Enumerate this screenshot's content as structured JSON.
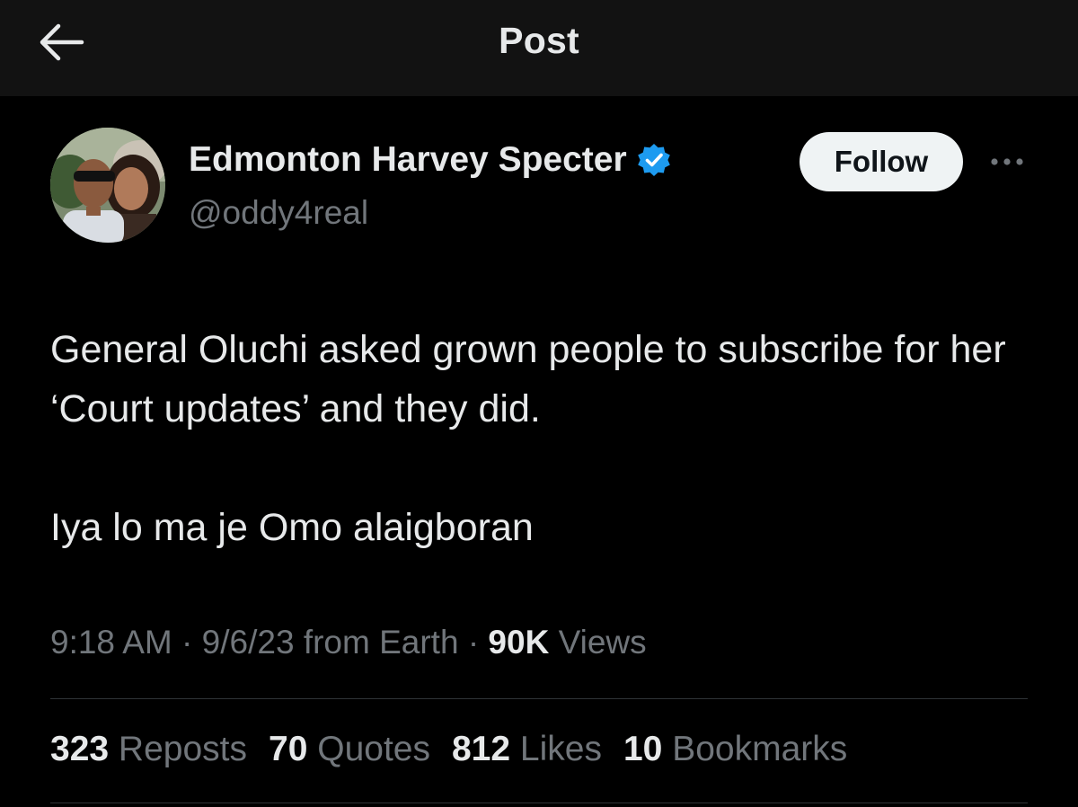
{
  "header": {
    "title": "Post",
    "back_icon": "arrow-left-icon"
  },
  "author": {
    "display_name": "Edmonton Harvey Specter",
    "handle": "@oddy4real",
    "verified_color": "#1d9bf0",
    "follow_label": "Follow",
    "more_icon": "more-dots-icon"
  },
  "tweet": {
    "paragraphs": [
      "General Oluchi asked grown people to subscribe for her ‘Court updates’ and they did.",
      "Iya lo ma je Omo alaigboran"
    ]
  },
  "meta": {
    "time": "9:18 AM",
    "date": "9/6/23",
    "source": "from Earth",
    "views_count": "90K",
    "views_label": "Views"
  },
  "stats": [
    {
      "count": "323",
      "label": "Reposts"
    },
    {
      "count": "70",
      "label": "Quotes"
    },
    {
      "count": "812",
      "label": "Likes"
    },
    {
      "count": "10",
      "label": "Bookmarks"
    }
  ]
}
